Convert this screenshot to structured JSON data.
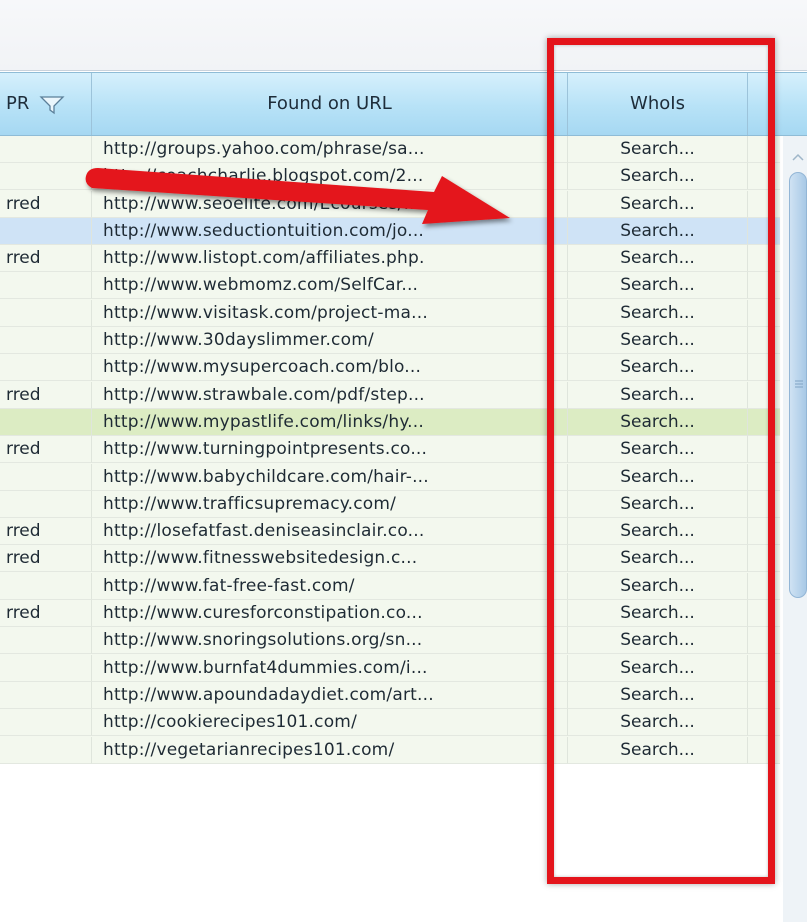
{
  "header": {
    "pr_label": "PR",
    "url_label": "Found on URL",
    "whois_label": "WhoIs"
  },
  "rows": [
    {
      "pr": "",
      "url": "http://groups.yahoo.com/phrase/sa...",
      "whois": "Search...",
      "style": "zebra"
    },
    {
      "pr": "",
      "url": "http://coachcharlie.blogspot.com/2...",
      "whois": "Search...",
      "style": "zebra"
    },
    {
      "pr": "rred",
      "url": "http://www.seoelite.com/Ecourses/...",
      "whois": "Search...",
      "style": "zebra"
    },
    {
      "pr": "",
      "url": "http://www.seductiontuition.com/jo...",
      "whois": "Search...",
      "style": "sel"
    },
    {
      "pr": "rred",
      "url": "http://www.listopt.com/affiliates.php.",
      "whois": "Search...",
      "style": "zebra"
    },
    {
      "pr": "",
      "url": "http://www.webmomz.com/SelfCar...",
      "whois": "Search...",
      "style": "zebra"
    },
    {
      "pr": "",
      "url": "http://www.visitask.com/project-ma...",
      "whois": "Search...",
      "style": "zebra"
    },
    {
      "pr": "",
      "url": "http://www.30dayslimmer.com/",
      "whois": "Search...",
      "style": "zebra"
    },
    {
      "pr": "",
      "url": "http://www.mysupercoach.com/blo...",
      "whois": "Search...",
      "style": "zebra"
    },
    {
      "pr": "rred",
      "url": "http://www.strawbale.com/pdf/step...",
      "whois": "Search...",
      "style": "zebra"
    },
    {
      "pr": "",
      "url": "http://www.mypastlife.com/links/hy...",
      "whois": "Search...",
      "style": "hl"
    },
    {
      "pr": "rred",
      "url": "http://www.turningpointpresents.co...",
      "whois": "Search...",
      "style": "zebra"
    },
    {
      "pr": "",
      "url": "http://www.babychildcare.com/hair-...",
      "whois": "Search...",
      "style": "zebra"
    },
    {
      "pr": "",
      "url": "http://www.trafficsupremacy.com/",
      "whois": "Search...",
      "style": "zebra"
    },
    {
      "pr": "rred",
      "url": "http://losefatfast.deniseasinclair.co...",
      "whois": "Search...",
      "style": "zebra"
    },
    {
      "pr": "rred",
      "url": "http://www.fitnesswebsitedesign.c...",
      "whois": "Search...",
      "style": "zebra"
    },
    {
      "pr": "",
      "url": "http://www.fat-free-fast.com/",
      "whois": "Search...",
      "style": "zebra"
    },
    {
      "pr": "rred",
      "url": "http://www.curesforconstipation.co...",
      "whois": "Search...",
      "style": "zebra"
    },
    {
      "pr": "",
      "url": "http://www.snoringsolutions.org/sn...",
      "whois": "Search...",
      "style": "zebra"
    },
    {
      "pr": "",
      "url": "http://www.burnfat4dummies.com/i...",
      "whois": "Search...",
      "style": "zebra"
    },
    {
      "pr": "",
      "url": "http://www.apoundadaydiet.com/art...",
      "whois": "Search...",
      "style": "zebra"
    },
    {
      "pr": "",
      "url": "http://cookierecipes101.com/",
      "whois": "Search...",
      "style": "zebra"
    },
    {
      "pr": "",
      "url": "http://vegetarianrecipes101.com/",
      "whois": "Search...",
      "style": "zebra"
    }
  ],
  "colors": {
    "annotation_red": "#e4141b",
    "header_blue": "#b7e2f7",
    "selected_row": "#cfe3f6",
    "highlighted_row": "#dcecc3"
  },
  "annotations": {
    "arrow": "red-arrow-pointing-right",
    "box": "red-rectangle-around-whois-column"
  }
}
